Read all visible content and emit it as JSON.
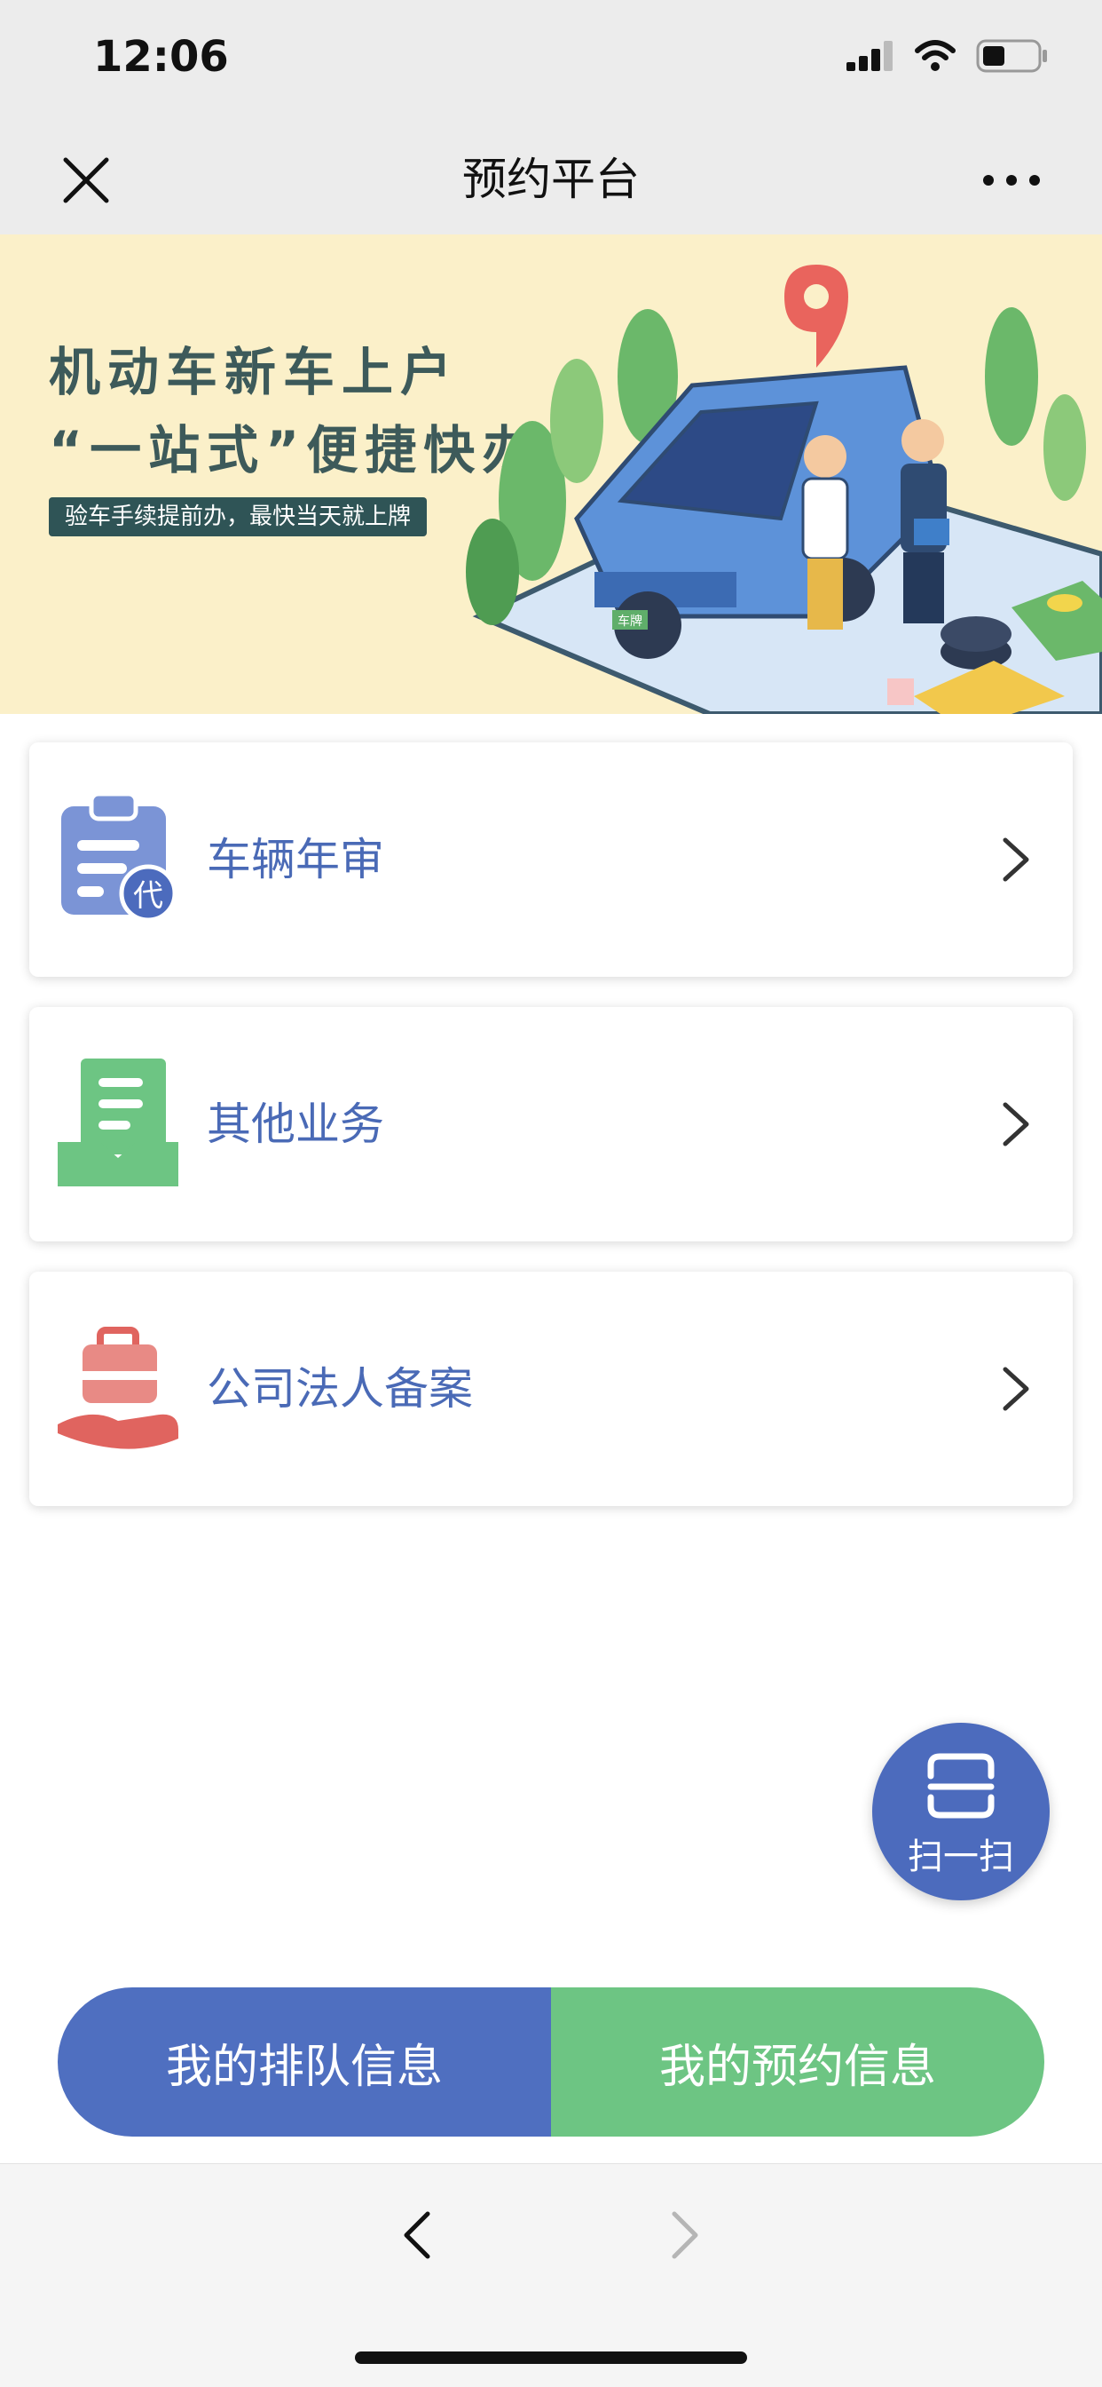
{
  "status_bar": {
    "time": "12:06",
    "signal_icon": "signal-bars-icon",
    "wifi_icon": "wifi-icon",
    "battery_icon": "battery-icon"
  },
  "nav": {
    "title": "预约平台",
    "close_icon": "close-icon",
    "more_icon": "more-dots-icon"
  },
  "banner": {
    "line1": "机动车新车上户",
    "line2": "“一站式”便捷快办",
    "tagline": "验车手续提前办，最快当天就上牌",
    "plate_text": "车牌"
  },
  "menu": [
    {
      "label": "车辆年审",
      "icon": "clipboard-agent-icon",
      "icon_badge": "代",
      "color": "#7b94d6"
    },
    {
      "label": "其他业务",
      "icon": "document-tray-icon",
      "color": "#6dc583"
    },
    {
      "label": "公司法人备案",
      "icon": "briefcase-hand-icon",
      "color": "#e0645f"
    }
  ],
  "scan": {
    "label": "扫一扫",
    "icon": "scan-frame-icon"
  },
  "bottom_buttons": {
    "left": "我的排队信息",
    "right": "我的预约信息"
  },
  "colors": {
    "primary_blue": "#4f6fc0",
    "primary_green": "#6dc583",
    "label_blue": "#4a6ab6",
    "banner_bg": "#fbf0c9"
  }
}
